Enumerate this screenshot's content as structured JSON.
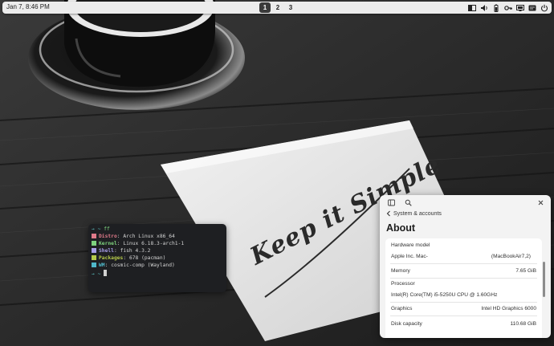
{
  "top_panel": {
    "clock": "Jan 7, 8:46 PM",
    "workspaces": [
      "1",
      "2",
      "3"
    ],
    "active_workspace": "1",
    "tray_icons": [
      "window-tiling-icon",
      "volume-icon",
      "battery-icon",
      "vpn-key-icon",
      "display-icon",
      "notification-icon",
      "power-icon"
    ]
  },
  "wallpaper": {
    "card_text": "Keep it Simple"
  },
  "terminal": {
    "prompt_arrow": "→",
    "prompt_tilde": "~",
    "command": "ff",
    "info": [
      {
        "key": "Distro",
        "value": "Arch Linux x86_64",
        "color": "#e07a8a"
      },
      {
        "key": "Kernel",
        "value": "Linux 6.18.3-arch1-1",
        "color": "#7ed17e"
      },
      {
        "key": "Shell",
        "value": "fish 4.3.2",
        "color": "#a89ee8"
      },
      {
        "key": "Packages",
        "value": "678 (pacman)",
        "color": "#b5c94a"
      },
      {
        "key": "WM",
        "value": "cosmic-comp (Wayland)",
        "color": "#4fb8c9"
      }
    ],
    "sep": ":"
  },
  "settings": {
    "back_label": "System & accounts",
    "heading": "About",
    "hardware_model_label": "Hardware model",
    "hardware_vendor": "Apple Inc. Mac-",
    "hardware_model_value": "(MacBookAir7,2)",
    "memory_label": "Memory",
    "memory_value": "7.65 GiB",
    "processor_label": "Processor",
    "processor_value": "Intel(R) Core(TM) i5-5250U CPU @ 1.60GHz",
    "graphics_label": "Graphics",
    "graphics_value": "Intel HD Graphics 6000",
    "disk_label": "Disk capacity",
    "disk_value": "110.68 GiB"
  }
}
